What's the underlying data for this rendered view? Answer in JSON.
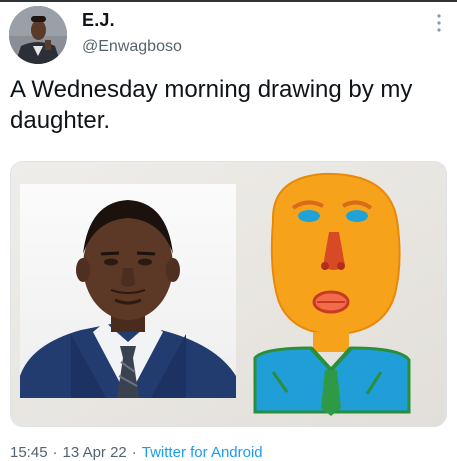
{
  "author": {
    "display_name": "E.J.",
    "handle": "@Enwagboso",
    "avatar_icon": "profile-photo"
  },
  "tweet": {
    "text": "A Wednesday morning drawing by my daughter.",
    "time": "15:45",
    "date": "13 Apr 22",
    "separator": "·",
    "source": "Twitter for Android"
  },
  "media": {
    "kind": "photo",
    "subjects": [
      "portrait-photo",
      "child-drawing"
    ]
  },
  "icons": {
    "more": "more-vertical-icon"
  },
  "colors": {
    "text": "#0f1419",
    "secondary": "#536471",
    "link": "#1d9bf0"
  }
}
